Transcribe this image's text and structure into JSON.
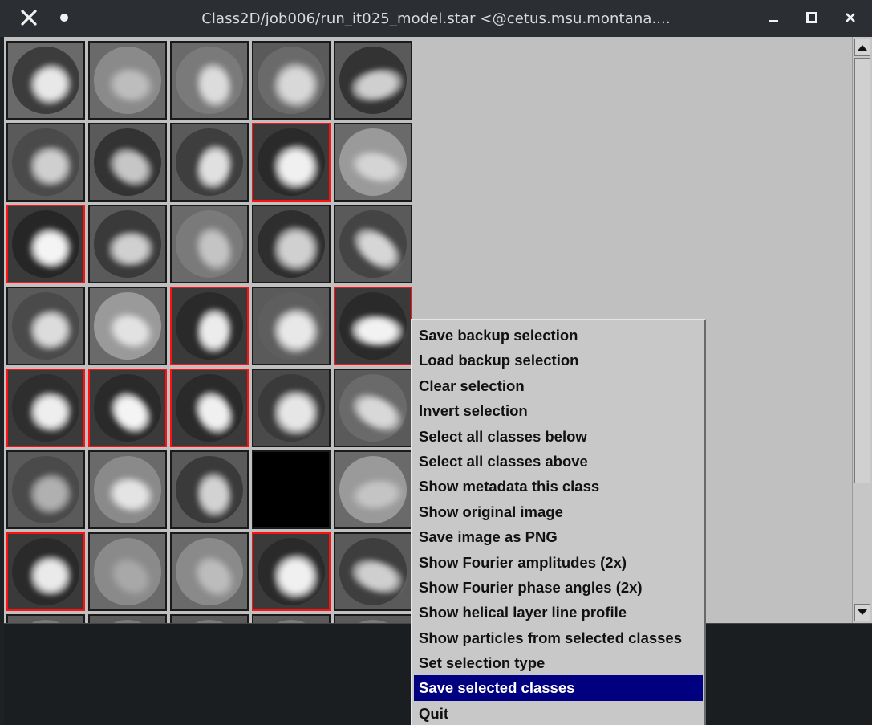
{
  "window": {
    "title": "Class2D/job006/run_it025_model.star <@cetus.msu.montana....",
    "icons": [
      "close-icon",
      "dot-icon",
      "minimize-icon",
      "maximize-icon",
      "close-icon"
    ]
  },
  "grid": {
    "columns": 5,
    "rows_visible": 7,
    "selected_border_color": "#ff1010",
    "cells": [
      {
        "selected": false,
        "bg": "#6a6a6a",
        "disc": "#3c3c3c",
        "blob": "#e8e8e8",
        "empty": false
      },
      {
        "selected": false,
        "bg": "#6a6a6a",
        "disc": "#8a8a8a",
        "blob": "#bdbdbd",
        "empty": false
      },
      {
        "selected": false,
        "bg": "#6a6a6a",
        "disc": "#7a7a7a",
        "blob": "#dcdcdc",
        "empty": false
      },
      {
        "selected": false,
        "bg": "#5a5a5a",
        "disc": "#6a6a6a",
        "blob": "#d8d8d8",
        "empty": false
      },
      {
        "selected": false,
        "bg": "#5a5a5a",
        "disc": "#333333",
        "blob": "#cfcfcf",
        "empty": false
      },
      {
        "selected": false,
        "bg": "#5a5a5a",
        "disc": "#4a4a4a",
        "blob": "#cfcfcf",
        "empty": false
      },
      {
        "selected": false,
        "bg": "#5a5a5a",
        "disc": "#333333",
        "blob": "#c6c6c6",
        "empty": false
      },
      {
        "selected": false,
        "bg": "#5a5a5a",
        "disc": "#3e3e3e",
        "blob": "#e0e0e0",
        "empty": false
      },
      {
        "selected": true,
        "bg": "#3a3a3a",
        "disc": "#2a2a2a",
        "blob": "#f0f0f0",
        "empty": false
      },
      {
        "selected": false,
        "bg": "#6a6a6a",
        "disc": "#9a9a9a",
        "blob": "#d4d4d4",
        "empty": false
      },
      {
        "selected": true,
        "bg": "#3a3a3a",
        "disc": "#262626",
        "blob": "#f4f4f4",
        "empty": false
      },
      {
        "selected": false,
        "bg": "#5a5a5a",
        "disc": "#3a3a3a",
        "blob": "#d0d0d0",
        "empty": false
      },
      {
        "selected": false,
        "bg": "#6a6a6a",
        "disc": "#7a7a7a",
        "blob": "#c4c4c4",
        "empty": false
      },
      {
        "selected": false,
        "bg": "#4a4a4a",
        "disc": "#2e2e2e",
        "blob": "#d0d0d0",
        "empty": false
      },
      {
        "selected": false,
        "bg": "#5a5a5a",
        "disc": "#444444",
        "blob": "#d6d6d6",
        "empty": false
      },
      {
        "selected": false,
        "bg": "#5a5a5a",
        "disc": "#4a4a4a",
        "blob": "#dcdcdc",
        "empty": false
      },
      {
        "selected": false,
        "bg": "#6a6a6a",
        "disc": "#9a9a9a",
        "blob": "#e2e2e2",
        "empty": false
      },
      {
        "selected": true,
        "bg": "#3a3a3a",
        "disc": "#2a2a2a",
        "blob": "#ececec",
        "empty": false
      },
      {
        "selected": false,
        "bg": "#5a5a5a",
        "disc": "#5e5e5e",
        "blob": "#e8e8e8",
        "empty": false
      },
      {
        "selected": true,
        "bg": "#3a3a3a",
        "disc": "#2a2a2a",
        "blob": "#f2f2f2",
        "empty": false
      },
      {
        "selected": true,
        "bg": "#3a3a3a",
        "disc": "#2e2e2e",
        "blob": "#eeeeee",
        "empty": false
      },
      {
        "selected": true,
        "bg": "#3a3a3a",
        "disc": "#2a2a2a",
        "blob": "#f4f4f4",
        "empty": false
      },
      {
        "selected": true,
        "bg": "#3a3a3a",
        "disc": "#2a2a2a",
        "blob": "#f0f0f0",
        "empty": false
      },
      {
        "selected": false,
        "bg": "#4a4a4a",
        "disc": "#3a3a3a",
        "blob": "#e6e6e6",
        "empty": false
      },
      {
        "selected": false,
        "bg": "#5a5a5a",
        "disc": "#6a6a6a",
        "blob": "#d8d8d8",
        "empty": false
      },
      {
        "selected": false,
        "bg": "#5a5a5a",
        "disc": "#4a4a4a",
        "blob": "#b0b0b0",
        "empty": false
      },
      {
        "selected": false,
        "bg": "#6a6a6a",
        "disc": "#8a8a8a",
        "blob": "#e4e4e4",
        "empty": false
      },
      {
        "selected": false,
        "bg": "#5a5a5a",
        "disc": "#3a3a3a",
        "blob": "#d2d2d2",
        "empty": false
      },
      {
        "selected": false,
        "bg": "#000000",
        "disc": "#000000",
        "blob": "#000000",
        "empty": true
      },
      {
        "selected": false,
        "bg": "#6a6a6a",
        "disc": "#9a9a9a",
        "blob": "#c4c4c4",
        "empty": false
      },
      {
        "selected": true,
        "bg": "#3a3a3a",
        "disc": "#2a2a2a",
        "blob": "#eaeaea",
        "empty": false
      },
      {
        "selected": false,
        "bg": "#6a6a6a",
        "disc": "#8a8a8a",
        "blob": "#a8a8a8",
        "empty": false
      },
      {
        "selected": false,
        "bg": "#6a6a6a",
        "disc": "#8a8a8a",
        "blob": "#bcbcbc",
        "empty": false
      },
      {
        "selected": true,
        "bg": "#3a3a3a",
        "disc": "#2a2a2a",
        "blob": "#f0f0f0",
        "empty": false
      },
      {
        "selected": false,
        "bg": "#5a5a5a",
        "disc": "#3e3e3e",
        "blob": "#cfcfcf",
        "empty": false
      },
      {
        "selected": false,
        "bg": "#5a5a5a",
        "disc": "#7a7a7a",
        "blob": "#bdbdbd",
        "empty": false
      },
      {
        "selected": false,
        "bg": "#5a5a5a",
        "disc": "#7a7a7a",
        "blob": "#bdbdbd",
        "empty": false
      },
      {
        "selected": false,
        "bg": "#5a5a5a",
        "disc": "#7a7a7a",
        "blob": "#bdbdbd",
        "empty": false
      },
      {
        "selected": false,
        "bg": "#5a5a5a",
        "disc": "#7a7a7a",
        "blob": "#bdbdbd",
        "empty": false
      },
      {
        "selected": false,
        "bg": "#5a5a5a",
        "disc": "#7a7a7a",
        "blob": "#bdbdbd",
        "empty": false
      }
    ]
  },
  "context_menu": {
    "highlight_color": "#000080",
    "items": [
      {
        "label": "Save backup selection",
        "highlighted": false
      },
      {
        "label": "Load backup selection",
        "highlighted": false
      },
      {
        "label": "Clear selection",
        "highlighted": false
      },
      {
        "label": "Invert selection",
        "highlighted": false
      },
      {
        "label": "Select all classes below",
        "highlighted": false
      },
      {
        "label": "Select all classes above",
        "highlighted": false
      },
      {
        "label": "Show metadata this class",
        "highlighted": false
      },
      {
        "label": "Show original image",
        "highlighted": false
      },
      {
        "label": "Save image as PNG",
        "highlighted": false
      },
      {
        "label": "Show Fourier amplitudes (2x)",
        "highlighted": false
      },
      {
        "label": "Show Fourier phase angles (2x)",
        "highlighted": false
      },
      {
        "label": "Show helical layer line profile",
        "highlighted": false
      },
      {
        "label": "Show particles from selected classes",
        "highlighted": false
      },
      {
        "label": "Set selection type",
        "highlighted": false
      },
      {
        "label": "Save selected classes",
        "highlighted": true
      },
      {
        "label": "Quit",
        "highlighted": false
      }
    ]
  }
}
